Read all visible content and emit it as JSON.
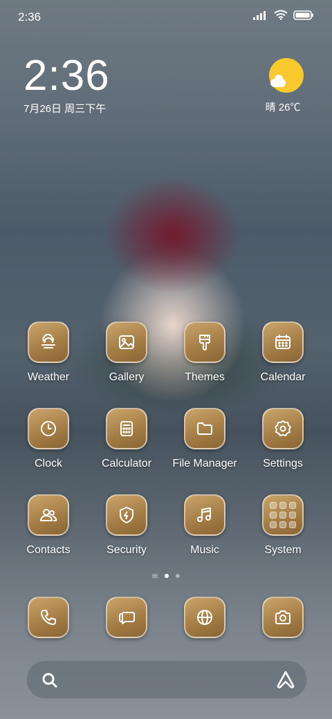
{
  "status_bar": {
    "time": "2:36",
    "icons": [
      "signal-icon",
      "wifi-icon",
      "battery-icon"
    ]
  },
  "clock_widget": {
    "time": "2:36",
    "date": "7月26日 周三下午"
  },
  "weather_widget": {
    "condition_icon": "sun-cloud-icon",
    "text": "晴 26℃"
  },
  "apps": [
    {
      "label": "Weather",
      "icon": "weather-icon"
    },
    {
      "label": "Gallery",
      "icon": "gallery-icon"
    },
    {
      "label": "Themes",
      "icon": "themes-icon"
    },
    {
      "label": "Calendar",
      "icon": "calendar-icon"
    },
    {
      "label": "Clock",
      "icon": "clock-icon"
    },
    {
      "label": "Calculator",
      "icon": "calculator-icon"
    },
    {
      "label": "File Manager",
      "icon": "folder-icon"
    },
    {
      "label": "Settings",
      "icon": "gear-icon"
    },
    {
      "label": "Contacts",
      "icon": "contacts-icon"
    },
    {
      "label": "Security",
      "icon": "shield-icon"
    },
    {
      "label": "Music",
      "icon": "music-icon"
    },
    {
      "label": "System",
      "icon": "folder-grid-icon"
    }
  ],
  "page_indicator": {
    "pages": 2,
    "current": 1
  },
  "dock": [
    {
      "icon": "phone-icon"
    },
    {
      "icon": "messages-icon"
    },
    {
      "icon": "browser-icon"
    },
    {
      "icon": "camera-icon"
    }
  ],
  "search_bar": {
    "search_icon": "search-icon",
    "assistant_icon": "assistant-icon"
  },
  "colors": {
    "icon_tile": "#a98149",
    "sun": "#f9c92d",
    "text": "#ffffff"
  }
}
